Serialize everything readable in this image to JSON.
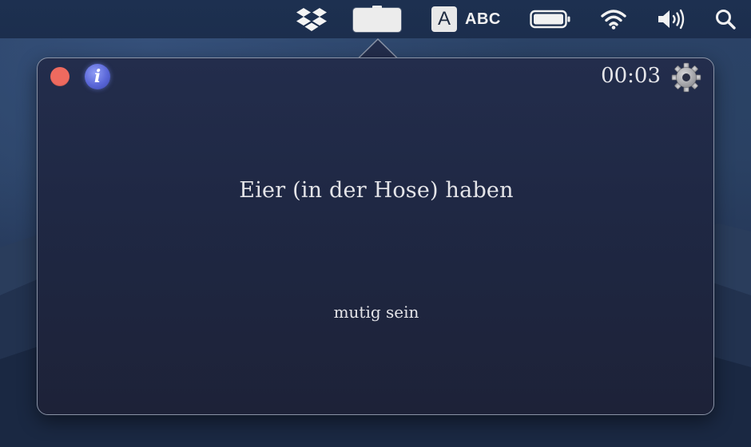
{
  "menubar": {
    "icons": [
      "dropbox-icon",
      "app-tray-icon",
      "input-source-icon",
      "battery-icon",
      "wifi-icon",
      "volume-icon",
      "spotlight-search-icon"
    ],
    "input_source": {
      "letter": "A",
      "label": "ABC"
    }
  },
  "popover": {
    "timer": "00:03",
    "info_glyph": "i",
    "term": "Eier (in der Hose) haben",
    "definition": "mutig sein",
    "icons": [
      "close-icon",
      "info-icon",
      "gear-icon"
    ]
  },
  "colors": {
    "close": "#ee6a5f",
    "info": "#5a67d8",
    "panel": "#1f2844",
    "text": "#e4e4e8"
  }
}
